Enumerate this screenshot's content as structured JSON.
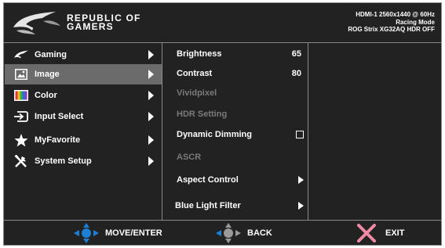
{
  "header": {
    "brand_line1": "REPUBLIC OF",
    "brand_line2": "GAMERS",
    "status_line1": "HDMI-1 2560x1440 @ 60Hz",
    "status_line2": "Racing Mode",
    "status_line3": "ROG Strix XG32AQ HDR OFF"
  },
  "menu": {
    "items": [
      {
        "label": "Gaming",
        "icon": "rog-eye-icon"
      },
      {
        "label": "Image",
        "icon": "image-icon",
        "active": true
      },
      {
        "label": "Color",
        "icon": "color-bars-icon"
      },
      {
        "label": "Input Select",
        "icon": "input-select-icon"
      },
      {
        "label": "MyFavorite",
        "icon": "star-icon"
      },
      {
        "label": "System Setup",
        "icon": "tools-icon"
      }
    ]
  },
  "submenu": {
    "items": [
      {
        "label": "Brightness",
        "value": "65"
      },
      {
        "label": "Contrast",
        "value": "80"
      },
      {
        "label": "Vividpixel",
        "disabled": true
      },
      {
        "label": "HDR Setting",
        "disabled": true
      },
      {
        "label": "Dynamic Dimming",
        "control": "checkbox",
        "checked": false
      },
      {
        "label": "ASCR",
        "disabled": true
      },
      {
        "label": "Aspect Control",
        "control": "arrow"
      },
      {
        "label": "Blue Light Filter",
        "control": "arrow"
      }
    ]
  },
  "footer": {
    "move_label": "MOVE/ENTER",
    "back_label": "BACK",
    "exit_label": "EXIT"
  },
  "colors": {
    "background": "#222222",
    "selection": "#6b6b6b",
    "border": "#8a8a8a",
    "disabled_text": "#7a7a7a",
    "joystick_blue": "#1f7fd4",
    "exit_pink": "#f08aa4"
  }
}
